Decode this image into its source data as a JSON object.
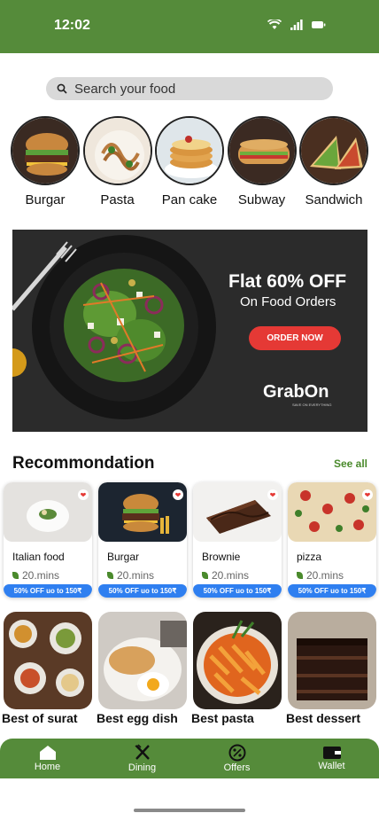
{
  "status_bar": {
    "time": "12:02"
  },
  "search": {
    "placeholder": "Search your food"
  },
  "categories": [
    {
      "label": "Burgar"
    },
    {
      "label": "Pasta"
    },
    {
      "label": "Pan cake"
    },
    {
      "label": "Subway"
    },
    {
      "label": "Sandwich"
    }
  ],
  "banner": {
    "headline": "Flat 60% OFF",
    "subheadline": "On Food Orders",
    "cta": "ORDER NOW",
    "brand": "GrabOn",
    "brand_tagline": "SAVE ON EVERYTHING"
  },
  "recommendation": {
    "title": "Recommondation",
    "see_all": "See all",
    "items": [
      {
        "name": "Italian food",
        "time": "20.mins",
        "offer": "50% OFF uo to 150₹"
      },
      {
        "name": "Burgar",
        "time": "20.mins",
        "offer": "50% OFF uo to 150₹"
      },
      {
        "name": "Brownie",
        "time": "20.mins",
        "offer": "50% OFF uo to 150₹"
      },
      {
        "name": "pizza",
        "time": "20.mins",
        "offer": "50% OFF uo to 150₹"
      }
    ]
  },
  "best": [
    {
      "label": "Best of surat"
    },
    {
      "label": "Best egg dish"
    },
    {
      "label": "Best pasta"
    },
    {
      "label": "Best dessert"
    }
  ],
  "bottom_nav": [
    {
      "label": "Home",
      "icon": "home-icon"
    },
    {
      "label": "Dining",
      "icon": "fork-knife-icon"
    },
    {
      "label": "Offers",
      "icon": "percent-badge-icon"
    },
    {
      "label": "Wallet",
      "icon": "wallet-icon"
    }
  ],
  "colors": {
    "primary": "#558b3a",
    "offer": "#2f7ff0",
    "cta": "#e53935",
    "search_bg": "#d9d9d9"
  }
}
